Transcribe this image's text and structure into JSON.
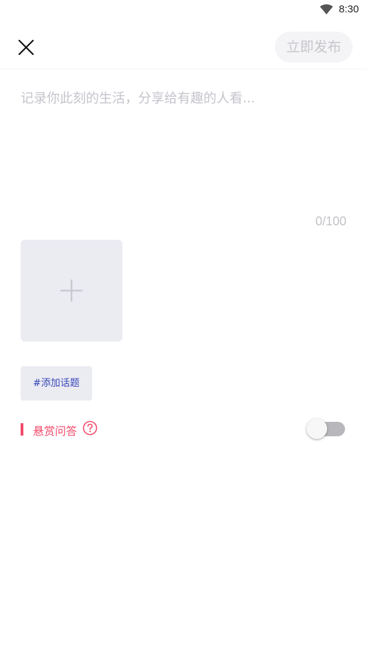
{
  "status_bar": {
    "time": "8:30",
    "wifi_icon": "wifi-icon"
  },
  "toolbar": {
    "close_icon": "close-icon",
    "publish_label": "立即发布"
  },
  "editor": {
    "placeholder": "记录你此刻的生活，分享给有趣的人看...",
    "value": "",
    "char_count": "0/100"
  },
  "media": {
    "add_icon": "plus-icon"
  },
  "topic": {
    "label": "#添加话题"
  },
  "reward": {
    "label": "悬赏问答",
    "help_icon": "question-circle-icon",
    "enabled": false
  },
  "colors": {
    "accent_red": "#f2496a",
    "topic_blue": "#3a4ab8",
    "tile_bg": "#ebebf2",
    "placeholder": "#c4c4cc"
  }
}
